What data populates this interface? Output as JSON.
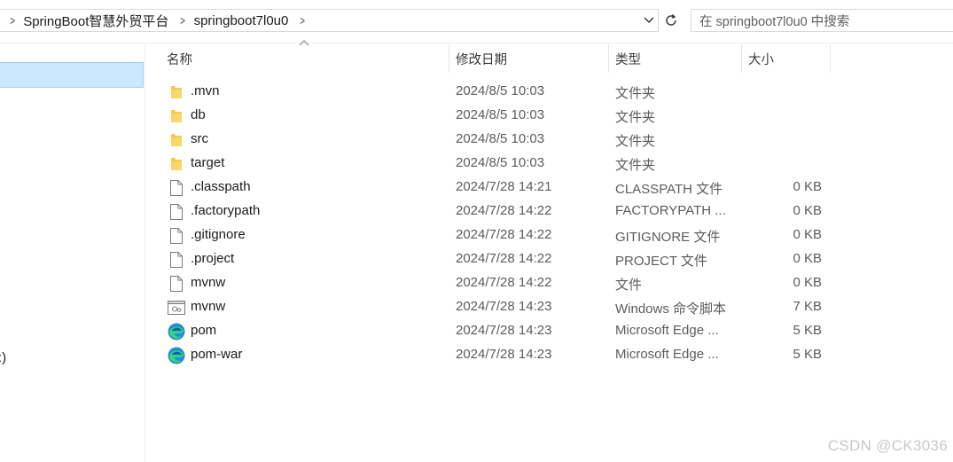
{
  "breadcrumb": {
    "items": [
      "SpringBoot智慧外贸平台",
      "springboot7l0u0"
    ]
  },
  "search": {
    "placeholder": "在 springboot7l0u0 中搜索"
  },
  "nav": {
    "drive_fragment": ":)"
  },
  "columns": {
    "name": "名称",
    "modified": "修改日期",
    "type": "类型",
    "size": "大小"
  },
  "files": [
    {
      "name": ".mvn",
      "modified": "2024/8/5 10:03",
      "type": "文件夹",
      "size": "",
      "icon": "folder-icon"
    },
    {
      "name": "db",
      "modified": "2024/8/5 10:03",
      "type": "文件夹",
      "size": "",
      "icon": "folder-icon"
    },
    {
      "name": "src",
      "modified": "2024/8/5 10:03",
      "type": "文件夹",
      "size": "",
      "icon": "folder-icon"
    },
    {
      "name": "target",
      "modified": "2024/8/5 10:03",
      "type": "文件夹",
      "size": "",
      "icon": "folder-icon"
    },
    {
      "name": ".classpath",
      "modified": "2024/7/28 14:21",
      "type": "CLASSPATH 文件",
      "size": "0 KB",
      "icon": "file-icon"
    },
    {
      "name": ".factorypath",
      "modified": "2024/7/28 14:22",
      "type": "FACTORYPATH ...",
      "size": "0 KB",
      "icon": "file-icon"
    },
    {
      "name": ".gitignore",
      "modified": "2024/7/28 14:22",
      "type": "GITIGNORE 文件",
      "size": "0 KB",
      "icon": "file-icon"
    },
    {
      "name": ".project",
      "modified": "2024/7/28 14:22",
      "type": "PROJECT 文件",
      "size": "0 KB",
      "icon": "file-icon"
    },
    {
      "name": "mvnw",
      "modified": "2024/7/28 14:22",
      "type": "文件",
      "size": "0 KB",
      "icon": "file-icon"
    },
    {
      "name": "mvnw",
      "modified": "2024/7/28 14:23",
      "type": "Windows 命令脚本",
      "size": "7 KB",
      "icon": "script-file-icon"
    },
    {
      "name": "pom",
      "modified": "2024/7/28 14:23",
      "type": "Microsoft Edge ...",
      "size": "5 KB",
      "icon": "edge-icon"
    },
    {
      "name": "pom-war",
      "modified": "2024/7/28 14:23",
      "type": "Microsoft Edge ...",
      "size": "5 KB",
      "icon": "edge-icon"
    }
  ],
  "watermark": "CSDN @CK3036",
  "colors": {
    "selection_bg": "#cce8ff",
    "selection_border": "#99d1ff",
    "folder_yellow": "#f8c846"
  }
}
